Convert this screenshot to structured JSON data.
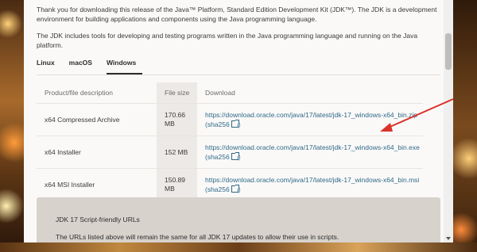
{
  "intro": {
    "p1": "Thank you for downloading this release of the Java™ Platform, Standard Edition Development Kit (JDK™). The JDK is a development environment for building applications and components using the Java programming language.",
    "p2": "The JDK includes tools for developing and testing programs written in the Java programming language and running on the Java platform."
  },
  "tabs": [
    {
      "label": "Linux"
    },
    {
      "label": "macOS"
    },
    {
      "label": "Windows",
      "active": true
    }
  ],
  "table": {
    "headers": [
      "Product/file description",
      "File size",
      "Download"
    ],
    "rows": [
      {
        "desc": "x64 Compressed Archive",
        "size": "170.66 MB",
        "url": "https://download.oracle.com/java/17/latest/jdk-17_windows-x64_bin.zip",
        "sha": "(sha256"
      },
      {
        "desc": "x64 Installer",
        "size": "152 MB",
        "url": "https://download.oracle.com/java/17/latest/jdk-17_windows-x64_bin.exe",
        "sha": "(sha256"
      },
      {
        "desc": "x64 MSI Installer",
        "size": "150.89 MB",
        "url": "https://download.oracle.com/java/17/latest/jdk-17_windows-x64_bin.msi",
        "sha": "(sha256"
      }
    ]
  },
  "script_box": {
    "title": "JDK 17 Script-friendly URLs",
    "text": "The URLs listed above will remain the same for all JDK 17 updates to allow their use in scripts."
  },
  "colors": {
    "link": "#2d6a88",
    "annotation_arrow": "#d9332b"
  }
}
